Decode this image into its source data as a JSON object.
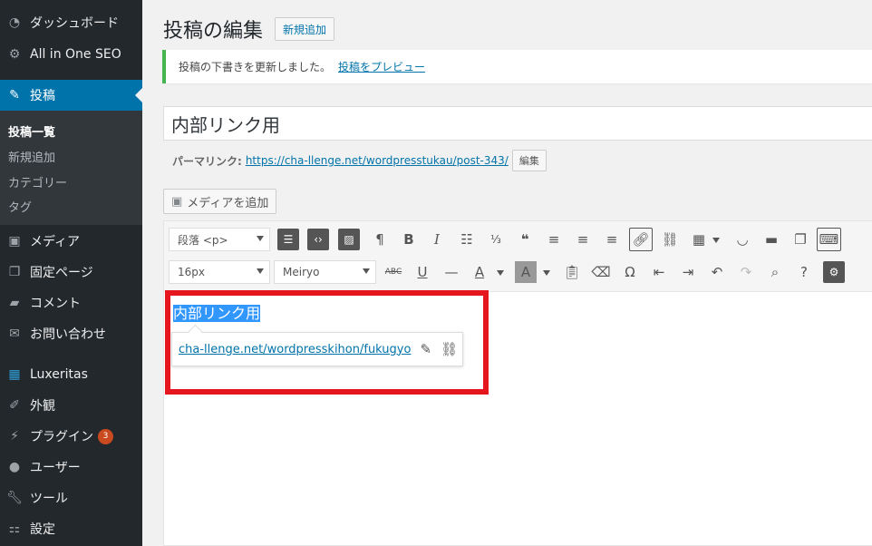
{
  "sidebar": {
    "items": [
      {
        "label": "ダッシュボード",
        "icon": "dashboard-icon"
      },
      {
        "label": "All in One SEO",
        "icon": "gear-icon"
      },
      {
        "label": "投稿",
        "icon": "pin-icon"
      },
      {
        "label": "メディア",
        "icon": "media-icon"
      },
      {
        "label": "固定ページ",
        "icon": "page-icon"
      },
      {
        "label": "コメント",
        "icon": "comment-icon"
      },
      {
        "label": "お問い合わせ",
        "icon": "mail-icon"
      },
      {
        "label": "Luxeritas",
        "icon": "luxeritas-icon"
      },
      {
        "label": "外観",
        "icon": "brush-icon"
      },
      {
        "label": "プラグイン",
        "icon": "plug-icon",
        "badge": "3"
      },
      {
        "label": "ユーザー",
        "icon": "user-icon"
      },
      {
        "label": "ツール",
        "icon": "wrench-icon"
      },
      {
        "label": "設定",
        "icon": "settings-icon"
      }
    ],
    "submenu": [
      "投稿一覧",
      "新規追加",
      "カテゴリー",
      "タグ"
    ]
  },
  "header": {
    "title": "投稿の編集",
    "add_new": "新規追加"
  },
  "notice": {
    "text": "投稿の下書きを更新しました。",
    "link": "投稿をプレビュー"
  },
  "post": {
    "title": "内部リンク用",
    "permalink_label": "パーマリンク:",
    "permalink_url": "https://cha-llenge.net/wordpresstukau/post-343/",
    "permalink_edit": "編集",
    "add_media": "メディアを追加"
  },
  "toolbar": {
    "format": "段落 <p>",
    "font_size": "16px",
    "font_family": "Meiryo"
  },
  "content": {
    "selected_text": "内部リンク用",
    "link_url": "cha-llenge.net/wordpresskihon/fukugyo"
  },
  "colors": {
    "accent": "#0073aa",
    "highlight_border": "#e6161f",
    "selection": "#3297fd",
    "badge": "#ca4a1f"
  }
}
